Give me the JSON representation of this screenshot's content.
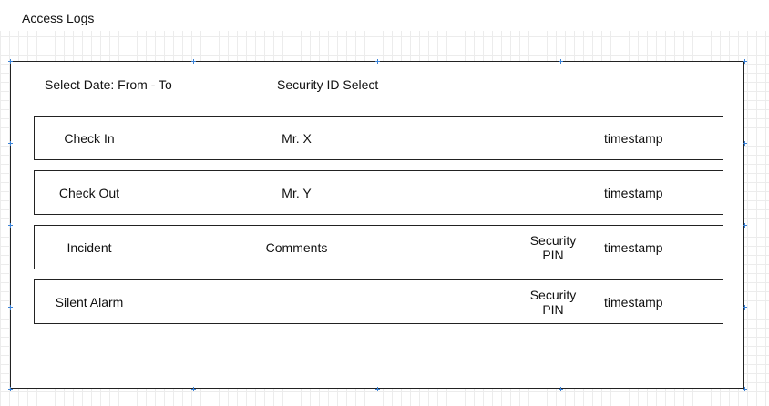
{
  "page": {
    "title": "Access Logs"
  },
  "filters": {
    "date_label": "Select Date: From - To",
    "security_label": "Security ID Select"
  },
  "rows": [
    {
      "type": "Check In",
      "subject": "Mr. X",
      "pin": "",
      "time": "timestamp"
    },
    {
      "type": "Check Out",
      "subject": "Mr. Y",
      "pin": "",
      "time": "timestamp"
    },
    {
      "type": "Incident",
      "subject": "Comments",
      "pin": "Security PIN",
      "time": "timestamp"
    },
    {
      "type": "Silent Alarm",
      "subject": "",
      "pin": "Security PIN",
      "time": "timestamp"
    }
  ],
  "colors": {
    "border": "#222222",
    "selection_handle": "#3b82d6",
    "grid": "#ececec"
  }
}
